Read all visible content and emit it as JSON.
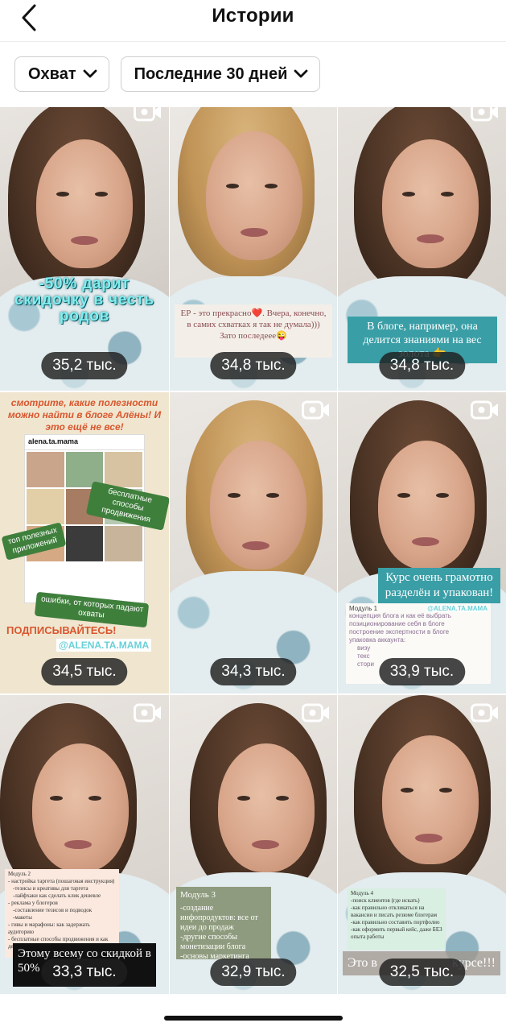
{
  "header": {
    "title": "Истории"
  },
  "filters": {
    "metric_label": "Охват",
    "period_label": "Последние 30 дней"
  },
  "colors": {
    "pill_bg": "#1e1e1e",
    "teal_caption": "#3a9ea6",
    "chip_border": "#cfcfcf"
  },
  "icons": {
    "back": "chevron-left-icon",
    "dropdown": "chevron-down-icon",
    "video": "video-camera-icon"
  },
  "stories": [
    {
      "reach": "35,2 тыс.",
      "has_video_icon": true,
      "caption": "-50% дарит скидочку в честь родов"
    },
    {
      "reach": "34,8 тыс.",
      "has_video_icon": false,
      "caption": "ЕР - это прекрасно❤️. Вчера, конечно, в самих схватках я так не думала))) Зато последеее😜"
    },
    {
      "reach": "34,8 тыс.",
      "has_video_icon": true,
      "caption": "В блоге, например, она делится знаниями на вес золота 👉"
    },
    {
      "reach": "34,5 тыс.",
      "has_video_icon": false,
      "promo_title": "смотрите, какие полезности можно найти в блоге Алёны! И это ещё не все!",
      "profile_handle": "alena.ta.mama",
      "sticker_1": "бесплатные способы продвижения",
      "sticker_2": "топ полезных приложений",
      "sticker_3": "ошибки, от которых падают охваты",
      "subscribe": "ПОДПИСЫВАЙТЕСЬ!",
      "mention": "@ALENA.TA.MAMA"
    },
    {
      "reach": "34,3 тыс.",
      "has_video_icon": true
    },
    {
      "reach": "33,9 тыс.",
      "has_video_icon": true,
      "caption": "Курс очень грамотно разделён и упакован!",
      "module_title": "Модуль 1",
      "mention": "@ALENA.TA.MAMA",
      "lines": [
        "концепция блога и как её выбрать",
        "позиционирование себя в блоге",
        "построение экспертности в блоге",
        "упаковка аккаунта:",
        "визу",
        "текс",
        "стори"
      ]
    },
    {
      "reach": "33,3 тыс.",
      "has_video_icon": true,
      "module_title": "Модуль 2",
      "lines": [
        "- настройка таргета (пошаговая инструкция)",
        "-тезисы и креативы для таргета",
        "-лайфхаки как сделать клик дешевле",
        "- реклама у блогеров",
        "-составление тезисов и подводок",
        "-макеты",
        "- гивы и марафоны: как задержать аудиторию",
        "- бесплатные способы продвижения и как делать их эффективнее"
      ],
      "caption": "Этому всему со скидкой в 50%"
    },
    {
      "reach": "32,9 тыс.",
      "has_video_icon": true,
      "module_title": "Модуль 3",
      "lines": [
        "-создание инфопродуктов: все от идеи до продаж",
        "-другие способы монетизации блога",
        "-основы маркетинга"
      ]
    },
    {
      "reach": "32,5 тыс.",
      "has_video_icon": true,
      "module_title": "Модуль 4",
      "lines": [
        "-поиск клиентов (где искать)",
        "-как правильно откликаться на вакансии и писать резюме блогерам",
        "-как правильно составить портфолио",
        "-как оформить первый кейс, даже БЕЗ опыта работы"
      ],
      "caption_left": "Это в",
      "caption_right": "курсе!!!"
    }
  ]
}
